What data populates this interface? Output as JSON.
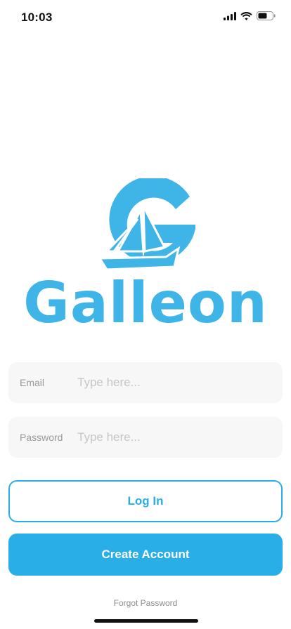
{
  "status_bar": {
    "time": "10:03",
    "icons": [
      "cellular-signal-icon",
      "wifi-icon",
      "battery-icon"
    ]
  },
  "logo": {
    "wordmark": "Galleon",
    "brand_color": "#3fb4e6",
    "icon": "galleon-ship-logo"
  },
  "form": {
    "email": {
      "label": "Email",
      "placeholder": "Type here..."
    },
    "password": {
      "label": "Password",
      "placeholder": "Type here..."
    }
  },
  "actions": {
    "login_label": "Log In",
    "create_account_label": "Create Account",
    "forgot_password_label": "Forgot Password",
    "accent_color": "#2aaee8"
  }
}
